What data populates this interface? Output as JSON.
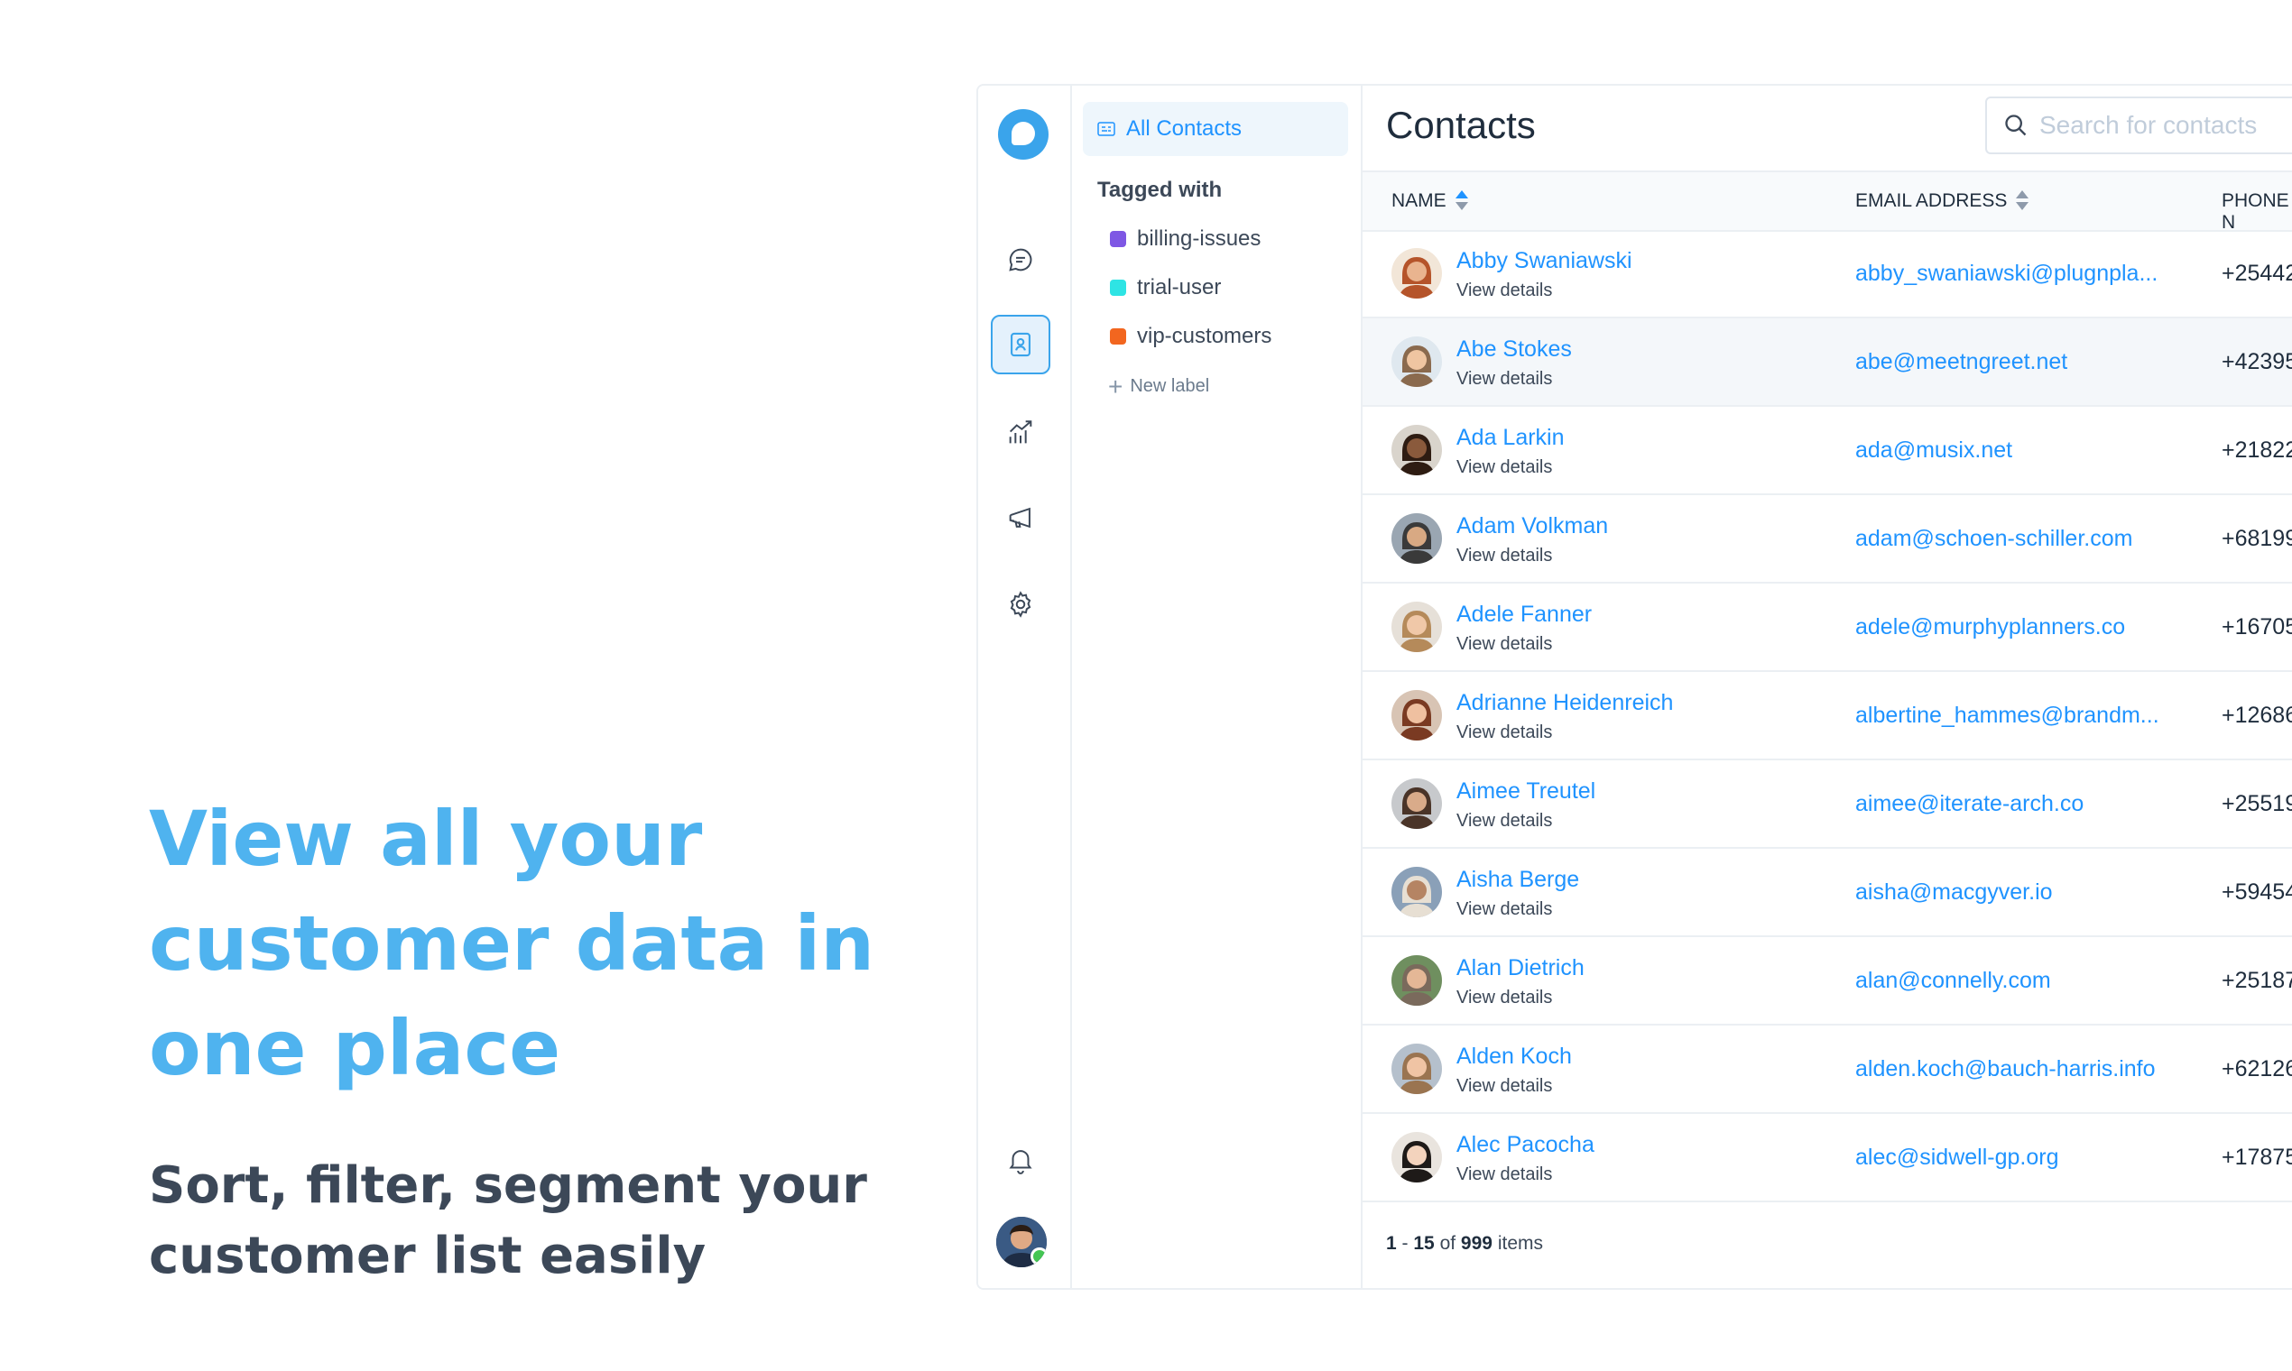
{
  "hero": {
    "title": "View all your customer data in one place",
    "subtitle": "Sort, filter, segment your customer list easily"
  },
  "nav": {
    "icons": [
      "chat-bubble-icon",
      "contacts-icon",
      "reports-icon",
      "megaphone-icon",
      "gear-icon",
      "bell-icon"
    ],
    "active": "contacts-icon"
  },
  "sidebar": {
    "all_contacts": "All Contacts",
    "tagged_heading": "Tagged with",
    "tags": [
      {
        "label": "billing-issues",
        "color": "#7e57e4"
      },
      {
        "label": "trial-user",
        "color": "#2ee4e4"
      },
      {
        "label": "vip-customers",
        "color": "#f2661f"
      }
    ],
    "new_label": "New label"
  },
  "main": {
    "title": "Contacts",
    "search_placeholder": "Search for contacts",
    "columns": {
      "name": "NAME",
      "email": "EMAIL ADDRESS",
      "phone": "PHONE N"
    },
    "contacts": [
      {
        "name": "Abby Swaniawski",
        "details": "View details",
        "email": "abby_swaniawski@plugnpla...",
        "phone": "+25442"
      },
      {
        "name": "Abe Stokes",
        "details": "View details",
        "email": "abe@meetngreet.net",
        "phone": "+42395"
      },
      {
        "name": "Ada Larkin",
        "details": "View details",
        "email": "ada@musix.net",
        "phone": "+21822"
      },
      {
        "name": "Adam Volkman",
        "details": "View details",
        "email": "adam@schoen-schiller.com",
        "phone": "+68199"
      },
      {
        "name": "Adele Fanner",
        "details": "View details",
        "email": "adele@murphyplanners.co",
        "phone": "+16705"
      },
      {
        "name": "Adrianne Heidenreich",
        "details": "View details",
        "email": "albertine_hammes@brandm...",
        "phone": "+12686"
      },
      {
        "name": "Aimee Treutel",
        "details": "View details",
        "email": "aimee@iterate-arch.co",
        "phone": "+25519"
      },
      {
        "name": "Aisha Berge",
        "details": "View details",
        "email": "aisha@macgyver.io",
        "phone": "+59454"
      },
      {
        "name": "Alan Dietrich",
        "details": "View details",
        "email": "alan@connelly.com",
        "phone": "+25187"
      },
      {
        "name": "Alden Koch",
        "details": "View details",
        "email": "alden.koch@bauch-harris.info",
        "phone": "+62126"
      },
      {
        "name": "Alec Pacocha",
        "details": "View details",
        "email": "alec@sidwell-gp.org",
        "phone": "+17875"
      }
    ],
    "pagination": {
      "start": "1",
      "end": "15",
      "total": "999",
      "of": "of",
      "unit": "items"
    }
  }
}
